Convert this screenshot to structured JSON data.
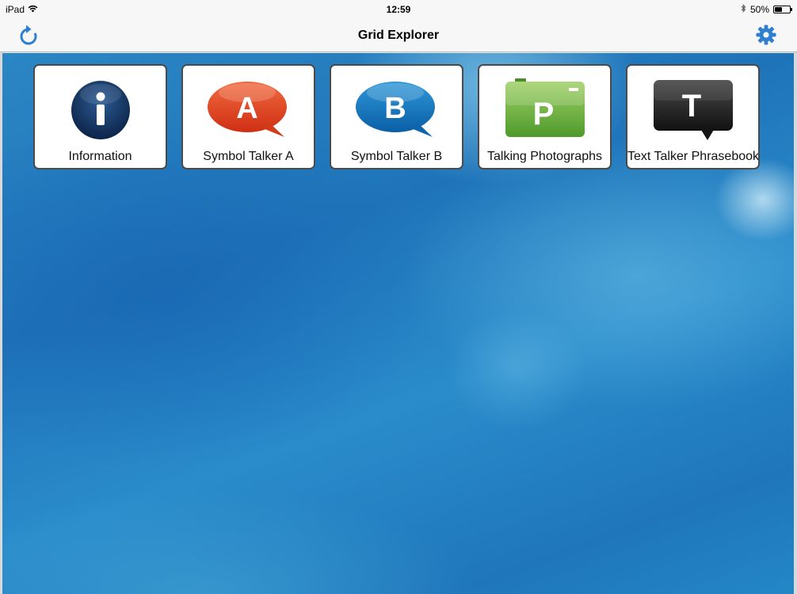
{
  "status_bar": {
    "device": "iPad",
    "time": "12:59",
    "battery": "50%",
    "battery_level": 0.5
  },
  "nav_bar": {
    "title": "Grid Explorer",
    "left_icon": "refresh-icon",
    "right_icon": "gear-icon"
  },
  "colors": {
    "accent": "#2f7fd0",
    "tile_border": "#4a4a4a",
    "background": "#1f74b9"
  },
  "tiles": [
    {
      "label": "Information",
      "icon": "information-icon",
      "letter": "i"
    },
    {
      "label": "Symbol Talker A",
      "icon": "symbol-talker-a-icon",
      "letter": "A"
    },
    {
      "label": "Symbol Talker B",
      "icon": "symbol-talker-b-icon",
      "letter": "B"
    },
    {
      "label": "Talking Photographs",
      "icon": "talking-photographs-icon",
      "letter": "P"
    },
    {
      "label": "Text Talker Phrasebook",
      "icon": "text-talker-phrasebook-icon",
      "letter": "T"
    }
  ]
}
